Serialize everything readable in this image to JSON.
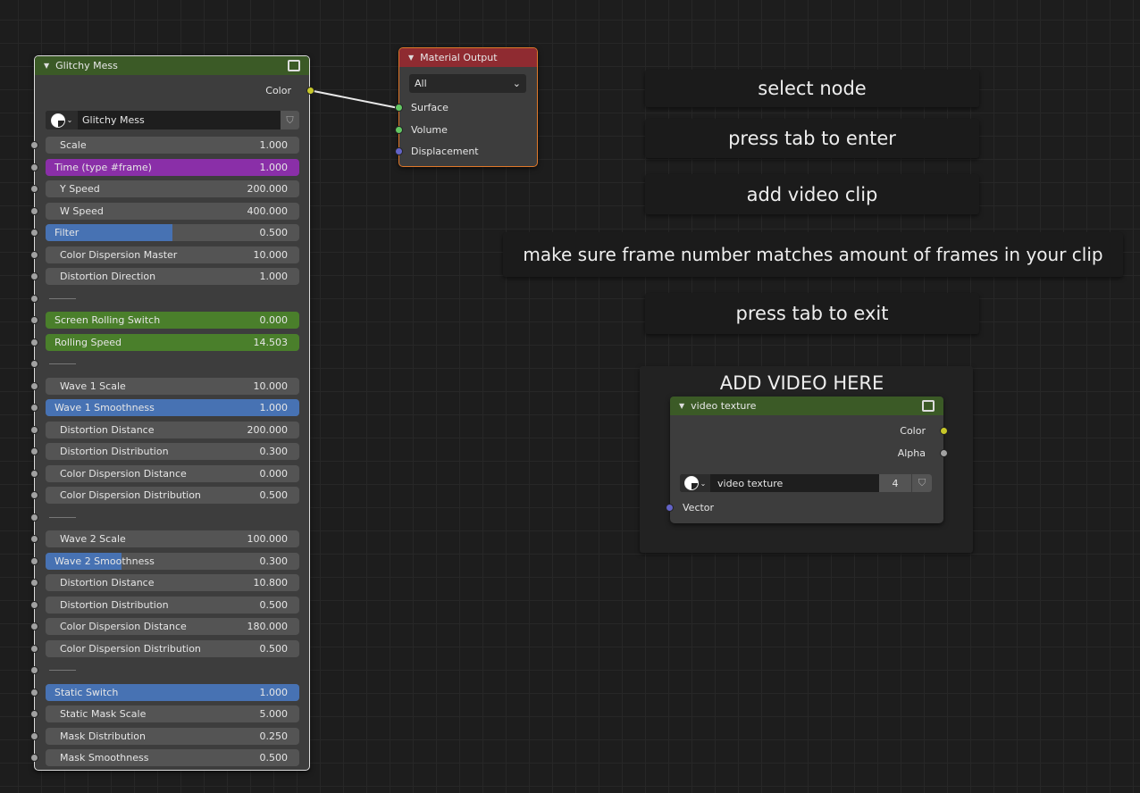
{
  "glitchy_node": {
    "title": "Glitchy Mess",
    "output": "Color",
    "datablock": "Glitchy Mess",
    "rows": [
      {
        "label": "Scale",
        "value": "1.000",
        "style": "normal"
      },
      {
        "label": "Time (type #frame)",
        "value": "1.000",
        "style": "purple"
      },
      {
        "label": "Y Speed",
        "value": "200.000",
        "style": "normal"
      },
      {
        "label": "W Speed",
        "value": "400.000",
        "style": "normal"
      },
      {
        "label": "Filter",
        "value": "0.500",
        "style": "factor",
        "fraction": 0.5
      },
      {
        "label": "Color Dispersion Master",
        "value": "10.000",
        "style": "normal"
      },
      {
        "label": "Distortion Direction",
        "value": "1.000",
        "style": "normal"
      },
      {
        "separator": true
      },
      {
        "label": "Screen Rolling Switch",
        "value": "0.000",
        "style": "green"
      },
      {
        "label": "Rolling Speed",
        "value": "14.503",
        "style": "green"
      },
      {
        "separator": true
      },
      {
        "label": "Wave 1 Scale",
        "value": "10.000",
        "style": "normal"
      },
      {
        "label": "Wave 1 Smoothness",
        "value": "1.000",
        "style": "factor",
        "fraction": 1.0
      },
      {
        "label": "Distortion Distance",
        "value": "200.000",
        "style": "normal"
      },
      {
        "label": "Distortion Distribution",
        "value": "0.300",
        "style": "normal"
      },
      {
        "label": "Color Dispersion Distance",
        "value": "0.000",
        "style": "normal"
      },
      {
        "label": "Color Dispersion  Distribution",
        "value": "0.500",
        "style": "normal"
      },
      {
        "separator": true
      },
      {
        "label": "Wave 2 Scale",
        "value": "100.000",
        "style": "normal"
      },
      {
        "label": "Wave 2 Smoothness",
        "value": "0.300",
        "style": "factor",
        "fraction": 0.3
      },
      {
        "label": "Distortion Distance",
        "value": "10.800",
        "style": "normal"
      },
      {
        "label": "Distortion Distribution",
        "value": "0.500",
        "style": "normal"
      },
      {
        "label": "Color Dispersion Distance",
        "value": "180.000",
        "style": "normal"
      },
      {
        "label": "Color Dispersion Distribution",
        "value": "0.500",
        "style": "normal"
      },
      {
        "separator": true
      },
      {
        "label": "Static Switch",
        "value": "1.000",
        "style": "factor",
        "fraction": 1.0
      },
      {
        "label": "Static Mask Scale",
        "value": "5.000",
        "style": "normal"
      },
      {
        "label": "Mask Distribution",
        "value": "0.250",
        "style": "normal"
      },
      {
        "label": "Mask Smoothness",
        "value": "0.500",
        "style": "normal"
      }
    ]
  },
  "material_output": {
    "title": "Material Output",
    "target": "All",
    "inputs": [
      "Surface",
      "Volume",
      "Displacement"
    ]
  },
  "notes": [
    "select node",
    "press tab to enter",
    "add video clip",
    "make sure frame number matches amount of frames in your clip",
    "press tab to exit"
  ],
  "frame": {
    "label": "ADD VIDEO HERE"
  },
  "video_node": {
    "title": "video texture",
    "outputs": [
      "Color",
      "Alpha"
    ],
    "datablock": "video texture",
    "users": "4",
    "input": "Vector"
  },
  "colors": {
    "group_header": "#3b5a26",
    "output_header": "#8f2b31",
    "purple": "#8a2fa8",
    "green": "#4a7f2b",
    "factor": "#4772b3",
    "yellow_socket": "#c7c729",
    "green_socket": "#63c763",
    "blue_socket": "#6363c7",
    "grey_socket": "#a1a1a1"
  }
}
